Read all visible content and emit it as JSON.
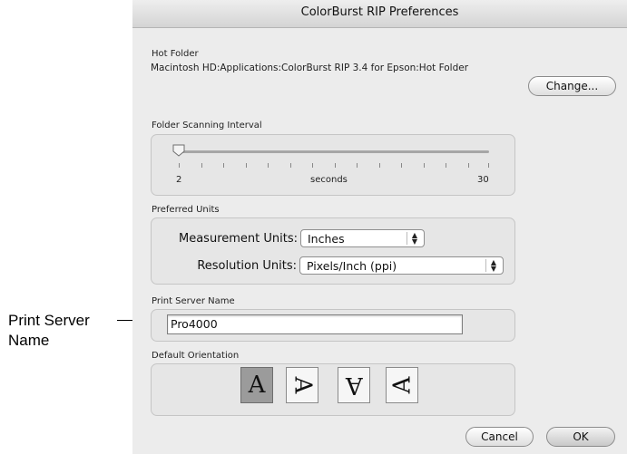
{
  "callout": {
    "line1": "Print Server",
    "line2": "Name"
  },
  "dialog": {
    "title": "ColorBurst RIP Preferences",
    "hot_folder": {
      "label": "Hot Folder",
      "path": "Macintosh HD:Applications:ColorBurst RIP 3.4 for Epson:Hot Folder",
      "change_label": "Change..."
    },
    "scanning": {
      "label": "Folder Scanning Interval",
      "min_label": "2",
      "unit_label": "seconds",
      "max_label": "30",
      "value": 2
    },
    "units": {
      "label": "Preferred Units",
      "measurement_label": "Measurement Units:",
      "measurement_value": "Inches",
      "resolution_label": "Resolution Units:",
      "resolution_value": "Pixels/Inch (ppi)"
    },
    "server": {
      "label": "Print Server Name",
      "value": "Pro4000"
    },
    "orientation": {
      "label": "Default Orientation",
      "options": [
        "A",
        "A",
        "A",
        "A"
      ],
      "selected_index": 0
    },
    "buttons": {
      "cancel": "Cancel",
      "ok": "OK"
    }
  }
}
